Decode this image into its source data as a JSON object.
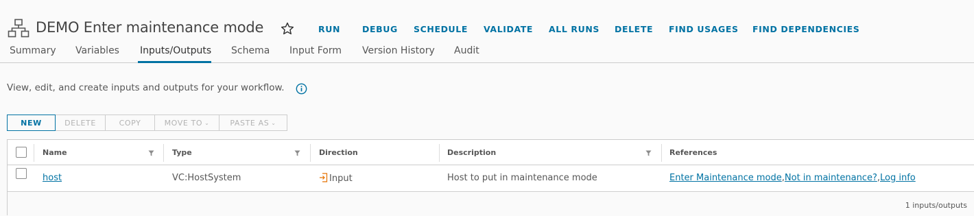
{
  "header": {
    "title": "DEMO Enter maintenance mode",
    "actions": [
      "RUN",
      "DEBUG",
      "SCHEDULE",
      "VALIDATE",
      "ALL RUNS",
      "DELETE",
      "FIND USAGES",
      "FIND DEPENDENCIES"
    ]
  },
  "tabs": [
    "Summary",
    "Variables",
    "Inputs/Outputs",
    "Schema",
    "Input Form",
    "Version History",
    "Audit"
  ],
  "active_tab": "Inputs/Outputs",
  "description": "View, edit, and create inputs and outputs for your workflow.",
  "toolbar": {
    "new": "NEW",
    "delete": "DELETE",
    "copy": "COPY",
    "move_to": "MOVE TO",
    "paste_as": "PASTE AS"
  },
  "grid": {
    "columns": [
      "Name",
      "Type",
      "Direction",
      "Description",
      "References"
    ],
    "rows": [
      {
        "name": "host",
        "type": "VC:HostSystem",
        "direction": "Input",
        "description": "Host to put in maintenance mode",
        "references": [
          "Enter Maintenance mode",
          "Not in maintenance?",
          "Log info"
        ]
      }
    ],
    "footer": "1 inputs/outputs"
  },
  "colors": {
    "accent": "#0072a3",
    "direction_icon": "#e57200"
  },
  "icons": {
    "workflow": "workflow-icon",
    "favorite": "star-icon",
    "info": "info-icon",
    "filter": "filter-icon",
    "direction_input": "input-arrow-icon"
  }
}
